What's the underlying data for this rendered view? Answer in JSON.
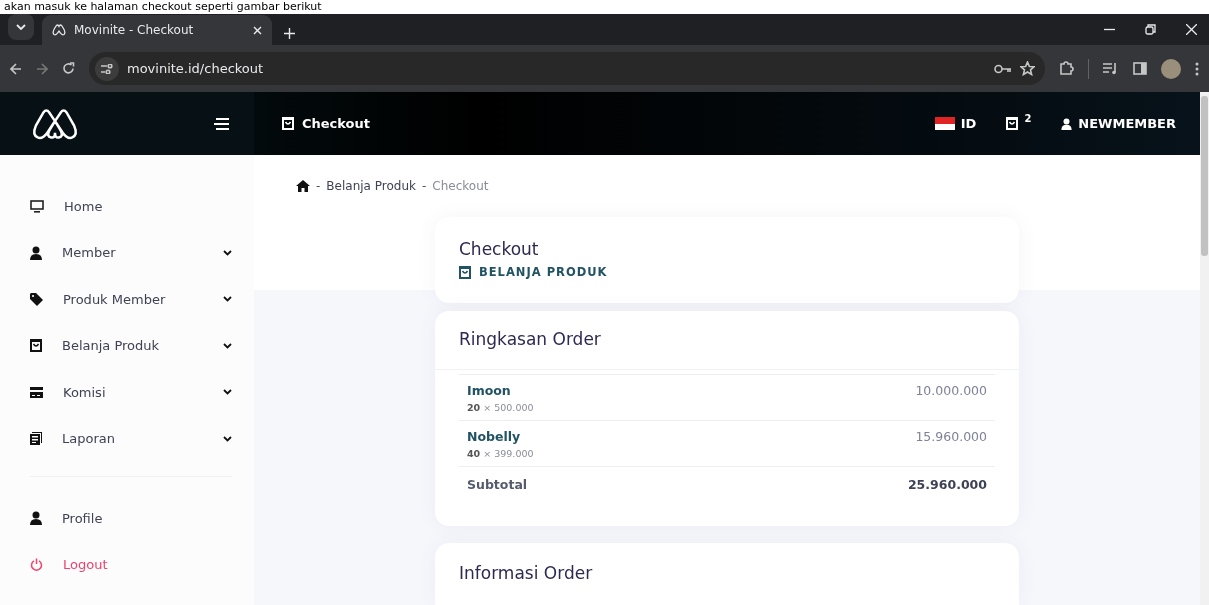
{
  "caption": "akan masuk ke halaman checkout seperti gambar berikut",
  "browser": {
    "tab_title": "Movinite - Checkout",
    "url": "movinite.id/checkout"
  },
  "header": {
    "title": "Checkout",
    "language": "ID",
    "cart_count": "2",
    "user": "NEWMEMBER"
  },
  "sidebar": {
    "items": [
      {
        "label": "Home",
        "expandable": false
      },
      {
        "label": "Member",
        "expandable": true
      },
      {
        "label": "Produk Member",
        "expandable": true
      },
      {
        "label": "Belanja Produk",
        "expandable": true
      },
      {
        "label": "Komisi",
        "expandable": true
      },
      {
        "label": "Laporan",
        "expandable": true
      }
    ],
    "bottom_items": [
      {
        "label": "Profile",
        "kind": "normal"
      },
      {
        "label": "Logout",
        "kind": "danger"
      }
    ]
  },
  "breadcrumb": [
    {
      "separator": "-",
      "label": "Belanja Produk"
    },
    {
      "separator": "-",
      "label": "Checkout"
    }
  ],
  "page_header": {
    "title": "Checkout",
    "subtitle": "BELANJA PRODUK"
  },
  "order_summary": {
    "title": "Ringkasan Order",
    "items": [
      {
        "name": "Imoon",
        "quantity_line": "**20** × 500.000",
        "total": "10.000.000"
      },
      {
        "name": "Nobelly",
        "quantity_line": "**40** × 399.000",
        "total": "15.960.000"
      }
    ],
    "subtotal_label": "Subtotal",
    "subtotal": "25.960.000"
  },
  "next_card": {
    "title": "Informasi Order"
  }
}
